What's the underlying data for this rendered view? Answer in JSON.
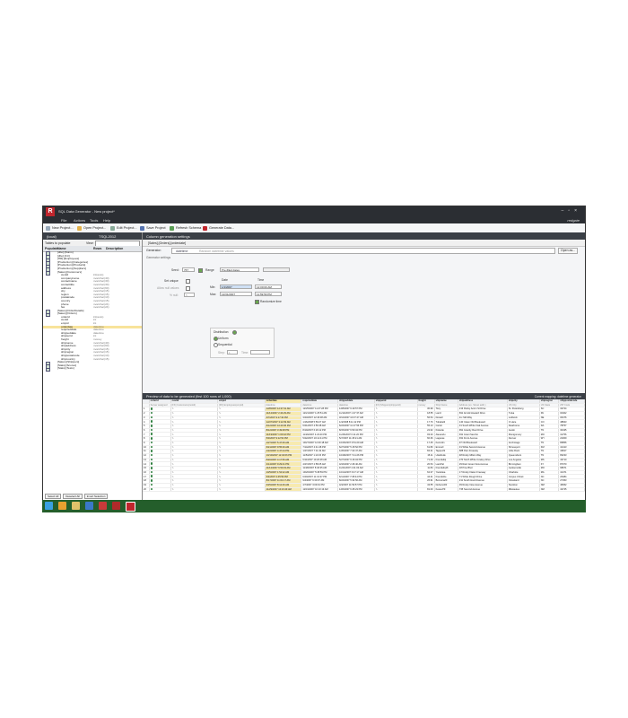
{
  "window": {
    "title": "SQL Data Generator - New project*",
    "brand": "redgate"
  },
  "menu": [
    "File",
    "Actions",
    "Tools",
    "Help"
  ],
  "toolbar": [
    {
      "label": "New Project...",
      "icon": "new-doc-icon"
    },
    {
      "label": "Open Project...",
      "icon": "folder-icon"
    },
    {
      "label": "Edit Project...",
      "icon": "edit-icon"
    },
    {
      "label": "Save Project",
      "icon": "save-icon"
    },
    {
      "label": "Refresh Schema",
      "icon": "refresh-icon"
    },
    {
      "label": "Generate Data...",
      "icon": "generate-icon"
    }
  ],
  "left": {
    "server": "(local)",
    "database": "TSQL2012",
    "populate_label": "Tables to populate",
    "view_label": "View:",
    "columns": {
      "populate": "Populate",
      "name": "Name",
      "rows": "Rows",
      "desc": "Description"
    },
    "rows": [
      {
        "name": "[dbo].[Nums]",
        "type": ""
      },
      {
        "name": "[dbo].[Ctr]",
        "type": ""
      },
      {
        "name": "[HR].[Employees]",
        "type": ""
      },
      {
        "name": "[Production].[Categories]",
        "type": ""
      },
      {
        "name": "[Production].[Products]",
        "type": ""
      },
      {
        "name": "[Production].[Suppliers]",
        "type": ""
      },
      {
        "name": "[Sales].[Customers]",
        "type": ""
      },
      {
        "name": "custid",
        "type": "int(auto)"
      },
      {
        "name": "companyname",
        "type": "nvarchar(40)"
      },
      {
        "name": "contactname",
        "type": "nvarchar(30)"
      },
      {
        "name": "contacttitle",
        "type": "nvarchar(30)"
      },
      {
        "name": "address",
        "type": "nvarchar(60)"
      },
      {
        "name": "city",
        "type": "nvarchar(15)"
      },
      {
        "name": "region",
        "type": "nvarchar(15)"
      },
      {
        "name": "postalcode",
        "type": "nvarchar(10)"
      },
      {
        "name": "country",
        "type": "nvarchar(15)"
      },
      {
        "name": "phone",
        "type": "nvarchar(24)"
      },
      {
        "name": "fax",
        "type": "nvarchar(24)"
      },
      {
        "name": "[Sales].[OrderDetails]",
        "type": ""
      },
      {
        "name": "[Sales].[Orders]",
        "type": ""
      },
      {
        "name": "orderid",
        "type": "int(auto)"
      },
      {
        "name": "custid",
        "type": "int"
      },
      {
        "name": "empid",
        "type": "int"
      },
      {
        "name": "orderdate",
        "type": "datetime"
      },
      {
        "name": "requireddate",
        "type": "datetime"
      },
      {
        "name": "shippeddate",
        "type": "datetime"
      },
      {
        "name": "shipperid",
        "type": "int"
      },
      {
        "name": "freight",
        "type": "money"
      },
      {
        "name": "shipname",
        "type": "nvarchar(40)"
      },
      {
        "name": "shipaddress",
        "type": "nvarchar(60)"
      },
      {
        "name": "shipcity",
        "type": "nvarchar(15)"
      },
      {
        "name": "shipregion",
        "type": "nvarchar(15)"
      },
      {
        "name": "shippostalcode",
        "type": "nvarchar(10)"
      },
      {
        "name": "shipcountry",
        "type": "nvarchar(15)"
      },
      {
        "name": "[Sales].[Shippers]",
        "type": ""
      },
      {
        "name": "[Stats].[Scores]",
        "type": ""
      },
      {
        "name": "[Stats].[Tests]",
        "type": ""
      }
    ],
    "buttons": [
      "Select All",
      "Deselect All",
      "Invert Selection"
    ]
  },
  "right": {
    "header": "Column generation settings",
    "crumb": "[Sales].[Orders].[orderdate]",
    "generator_label": "Generator:",
    "generator_value": "datetime",
    "generator_hint": "Random datetime values",
    "open_btn": "Open as...",
    "settings": "Generator settings",
    "seed_label": "Seed:",
    "seed_value": "767",
    "range_label": "Range",
    "range_value": "Pre-filled dates",
    "set_unique": "Set unique",
    "allow_null": "Allow null values",
    "pct_null": "% null:",
    "pct_value": "5",
    "date_label": "Date",
    "time_label": "Time",
    "min_label": "Min:",
    "max_label": "Max:",
    "min_date": "1/1/2007",
    "max_date": "12/31/2007",
    "min_time": "12:00:00 AM",
    "max_time": "11:59:59 PM",
    "randomize": "Randomize time",
    "distribution": "Distribution",
    "dist_uniform": "Uniform",
    "dist_sequential": "Sequential",
    "step_label": "Step:",
    "step_value": "1",
    "time_step": "Time:",
    "grid_title": "Preview of data to be generated (first 100 rows of 1,000)",
    "grid_right": "Current mapping: datetime generator"
  },
  "grid": {
    "columns": [
      "",
      "orderid",
      "custid",
      "empid",
      "orderdate",
      "requireddate",
      "shippeddate",
      "shipperid",
      "freight",
      "shipname",
      "shipaddress",
      "shipcity",
      "shipregion",
      "shippostalcode"
    ],
    "subtitles": [
      "",
      "Server assigned",
      "[FK] Customers(custid)",
      "[FK] Employees(empid)",
      "datetime",
      "datetime",
      "datetime",
      "[FK] Shippers(shipperid)",
      "money",
      "Ship Name",
      "Address (ex. Street addr.)",
      "US City",
      "US State",
      "ZIP Code"
    ],
    "rows": [
      [
        "1",
        "12/8/2007 12:37:31 AM",
        "12/25/2007 11:27:28 PM",
        "12/8/2007 9:19:57 PM",
        "30.99",
        "Tony",
        "213 Rocky Acorn St Drive",
        "St. Petersburg",
        "SC",
        "32724"
      ],
      [
        "2",
        "11/12/2007 2:44:29 AM",
        "12/21/2007 1:25:51 AM",
        "11/12/2007 1:27:37 AM",
        "18.55",
        "Lantz",
        "691 Arnold Howard Drive",
        "Tulsa",
        "PA",
        "04402"
      ],
      [
        "3",
        "3/7/2007 9:17:30 PM",
        "3/23/2007 12:46:38 AM",
        "3/12/2007 10:37:47 AM",
        "56.54",
        "Dowell",
        "Inc Still Way",
        "Lubbock",
        "NE",
        "06476"
      ],
      [
        "4",
        "12/27/2007 3:12:39 AM",
        "1/16/2008 5:59:27 AM",
        "1/4/2008 8:11:12 PM",
        "17.76",
        "Tubabelli",
        "140 Clean Old Boulevard",
        "O Hare",
        "CO",
        "48843"
      ],
      [
        "5",
        "6/12/2007 10:20:36 PM",
        "6/21/2007 4:56:48 AM",
        "6/24/2007 11:17:56 PM",
        "55.13",
        "Carvin",
        "31 South White Oak Avenue",
        "Dearborne",
        "DA",
        "78757"
      ],
      [
        "6",
        "8/12/2007 3:49:08 PM",
        "8/19/2007 6:29:12 PM",
        "8/15/2007 6:50:34 PM",
        "22.62",
        "Kickette",
        "991 Granby Root Drive",
        "Austin",
        "TN",
        "30435"
      ],
      [
        "7",
        "11/19/2007 1:00:42 PM",
        "11/29/2007 4:23:40 PM",
        "11/26/2007 6:11:20 PM",
        "93.33",
        "Alexandu",
        "931 Grant Sancho",
        "Montgomery",
        "MO",
        "31756"
      ],
      [
        "8",
        "5/3/2007 9:12:54 PM",
        "5/22/2007 10:12:41 PM",
        "5/7/2007 11:45:21 AM",
        "60.36",
        "Lagesse",
        "931 Front Avenue",
        "Denver",
        "WY",
        "22309"
      ],
      [
        "9",
        "10/7/2007 5:47:06 AM",
        "10/27/2007 12:00:18 AM",
        "10/15/2007 6:51:29 AM",
        "17.45",
        "Kerrettin",
        "97 Old Boulevard",
        "Anchorage",
        "TN",
        "86856"
      ],
      [
        "10",
        "6/21/2007 9:55:26 AM",
        "7/14/2007 4:41:48 PM",
        "6/27/2007 5:15:52 PM",
        "61.83",
        "Emmell",
        "31 White Second Avenue",
        "Shreveport",
        "KM",
        "41413"
      ],
      [
        "11",
        "1/22/2007 4:47:44 PM",
        "1/27/2007 7:11:43 AM",
        "1/26/2007 7:22:47 AM",
        "84.21",
        "Tappenfit",
        "688 Pam Freeway",
        "Little Rock",
        "TN",
        "43817"
      ],
      [
        "12",
        "10/10/2007 12:32:06 PM",
        "11/5/2007 1:10:15 PM",
        "10/18/2007 7:41:26 PM",
        "15.11",
        "Uslefrede",
        "48 Rocky Milton Way",
        "Queensboro",
        "TN",
        "83233"
      ],
      [
        "13",
        "5/20/2007 4:17:50 AM",
        "6/11/2007 10:20:28 AM",
        "5/27/2007 9:16:04 PM",
        "71.49",
        "Frendsdiq",
        "270 North White Cowley Drive",
        "Los Angeles",
        "MS",
        "43710"
      ],
      [
        "14",
        "4/14/2007 9:29:41 PM",
        "4/27/2007 2:58:25 AM",
        "4/16/2007 2:46:40 AM",
        "20.54",
        "Lantrifel",
        "29 Rain Green New Avenue",
        "Birmingham",
        "KY",
        "87070"
      ],
      [
        "15",
        "11/12/2007 6:50:33 AM",
        "11/28/2007 8:46:35 AM",
        "11/21/2007 4:41:03 AM",
        "11.84",
        "Frendsdq16",
        "18 Pine Blvd",
        "Jacksonville",
        "MO",
        "68971"
      ],
      [
        "16",
        "10/5/2007 1:54:22 AM",
        "10/26/2007 5:38:59 PM",
        "10/14/2007 6:47:17 AM",
        "62.37",
        "Yoolettea",
        "17 Rocky Flaten Freeway",
        "Charlotte",
        "MA",
        "41471"
      ],
      [
        "17",
        "6/4/2007 2:45:59 PM",
        "6/20/2007 11:31:37 PM",
        "6/11/2007 7:08:44 PM",
        "44.21",
        "Frendslize",
        "71 White Rough Drive",
        "Corpus Christi",
        "NC",
        "26484"
      ],
      [
        "18",
        "8/17/2007 11:01:17 AM",
        "9/4/2007 6:30:07 AM",
        "8/24/2007 5:34:56 AM",
        "26.91",
        "Bonnera20",
        "211 South Hood Avenue",
        "Cleveland",
        "NC",
        "27453"
      ],
      [
        "19",
        "3/25/2007 8:12:46 AM",
        "4/7/2007 3:09:01 PM",
        "4/3/2007 11:59:57 PM",
        "43.55",
        "Dehenni00",
        "39 Rocky New Avenue",
        "Stockton",
        "NM",
        "48452"
      ],
      [
        "20",
        "11/29/2007 10:23:49 AM",
        "12/19/2007 10:13:13 AM",
        "12/6/2007 6:45:23 PM",
        "81.00",
        "Kessel79",
        "735 Second Avenue",
        "Milwaukee",
        "NM",
        "42745"
      ]
    ]
  },
  "colors": {
    "chrome": "#2b2e33",
    "accent": "#c0262d",
    "highlight": "#f7eab0",
    "taskbar": "#245e2b"
  }
}
